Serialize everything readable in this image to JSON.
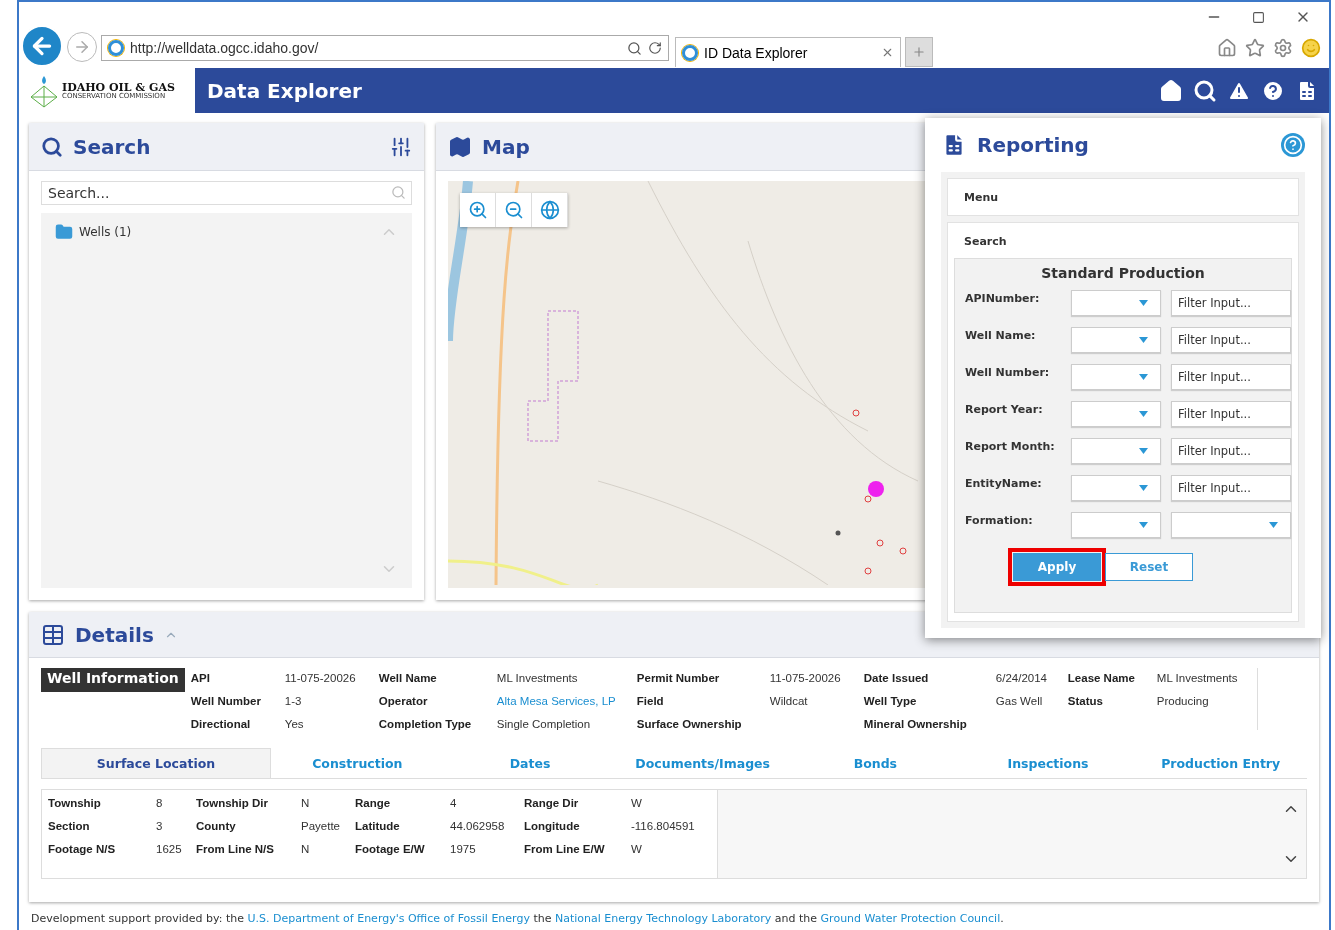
{
  "browser": {
    "url": "http://welldata.ogcc.idaho.gov/",
    "tab_title": "ID Data Explorer"
  },
  "app": {
    "logo_title": "IDAHO OIL & GAS",
    "logo_subtitle": "CONSERVATION COMMISSION",
    "title": "Data Explorer"
  },
  "search_panel": {
    "title": "Search",
    "placeholder": "Search...",
    "tree": [
      {
        "label": "Wells (1)"
      }
    ]
  },
  "map_panel": {
    "title": "Map"
  },
  "reporting": {
    "title": "Reporting",
    "sections": [
      {
        "label": "Menu"
      },
      {
        "label": "Search"
      }
    ],
    "form_title": "Standard Production",
    "fields": [
      {
        "label": "APINumber:",
        "kind": "filter",
        "placeholder": "Filter Input..."
      },
      {
        "label": "Well Name:",
        "kind": "filter",
        "placeholder": "Filter Input..."
      },
      {
        "label": "Well Number:",
        "kind": "filter",
        "placeholder": "Filter Input..."
      },
      {
        "label": "Report Year:",
        "kind": "filter",
        "placeholder": "Filter Input..."
      },
      {
        "label": "Report Month:",
        "kind": "filter",
        "placeholder": "Filter Input..."
      },
      {
        "label": "EntityName:",
        "kind": "filter",
        "placeholder": "Filter Input..."
      },
      {
        "label": "Formation:",
        "kind": "select"
      }
    ],
    "buttons": [
      {
        "label": "Apply",
        "kind": "primary",
        "highlighted": true
      },
      {
        "label": "Reset",
        "kind": "secondary",
        "highlighted": false
      }
    ]
  },
  "details": {
    "title": "Details",
    "heading": "Well Information",
    "info": [
      {
        "label": "API",
        "value": "11-075-20026"
      },
      {
        "label": "Well Name",
        "value": "ML Investments"
      },
      {
        "label": "Permit Number",
        "value": "11-075-20026"
      },
      {
        "label": "Date Issued",
        "value": "6/24/2014"
      },
      {
        "label": "Lease Name",
        "value": "ML Investments"
      },
      {
        "label": "Well Number",
        "value": "1-3"
      },
      {
        "label": "Operator",
        "value": "Alta Mesa Services, LP",
        "link": true
      },
      {
        "label": "Field",
        "value": "Wildcat"
      },
      {
        "label": "Well Type",
        "value": "Gas Well"
      },
      {
        "label": "Status",
        "value": "Producing"
      },
      {
        "label": "Directional",
        "value": "Yes"
      },
      {
        "label": "Completion Type",
        "value": "Single Completion"
      },
      {
        "label": "Surface Ownership"
      },
      {
        "label": "Mineral Ownership"
      }
    ],
    "tabs": [
      {
        "label": "Surface Location",
        "selected": true
      },
      {
        "label": "Construction",
        "selected": false
      },
      {
        "label": "Dates",
        "selected": false
      },
      {
        "label": "Documents/Images",
        "selected": false
      },
      {
        "label": "Bonds",
        "selected": false
      },
      {
        "label": "Inspections",
        "selected": false
      },
      {
        "label": "Production Entry",
        "selected": false
      }
    ],
    "location": [
      {
        "label": "Township",
        "value": "8"
      },
      {
        "label": "Township Dir",
        "value": "N"
      },
      {
        "label": "Range",
        "value": "4"
      },
      {
        "label": "Range Dir",
        "value": "W"
      },
      {
        "label": "Section",
        "value": "3"
      },
      {
        "label": "County",
        "value": "Payette"
      },
      {
        "label": "Latitude",
        "value": "44.062958"
      },
      {
        "label": "Longitude",
        "value": "-116.804591"
      },
      {
        "label": "Footage N/S",
        "value": "1625"
      },
      {
        "label": "From Line N/S",
        "value": "N"
      },
      {
        "label": "Footage E/W",
        "value": "1975"
      },
      {
        "label": "From Line E/W",
        "value": "W"
      }
    ]
  },
  "footer": [
    {
      "text": "Development support provided by: the "
    },
    {
      "text": "U.S. Department of Energy's Office of Fossil Energy",
      "link": true
    },
    {
      "text": " the "
    },
    {
      "text": "National Energy Technology Laboratory",
      "link": true
    },
    {
      "text": " and the "
    },
    {
      "text": "Ground Water Protection Council",
      "link": true
    },
    {
      "text": "."
    }
  ]
}
